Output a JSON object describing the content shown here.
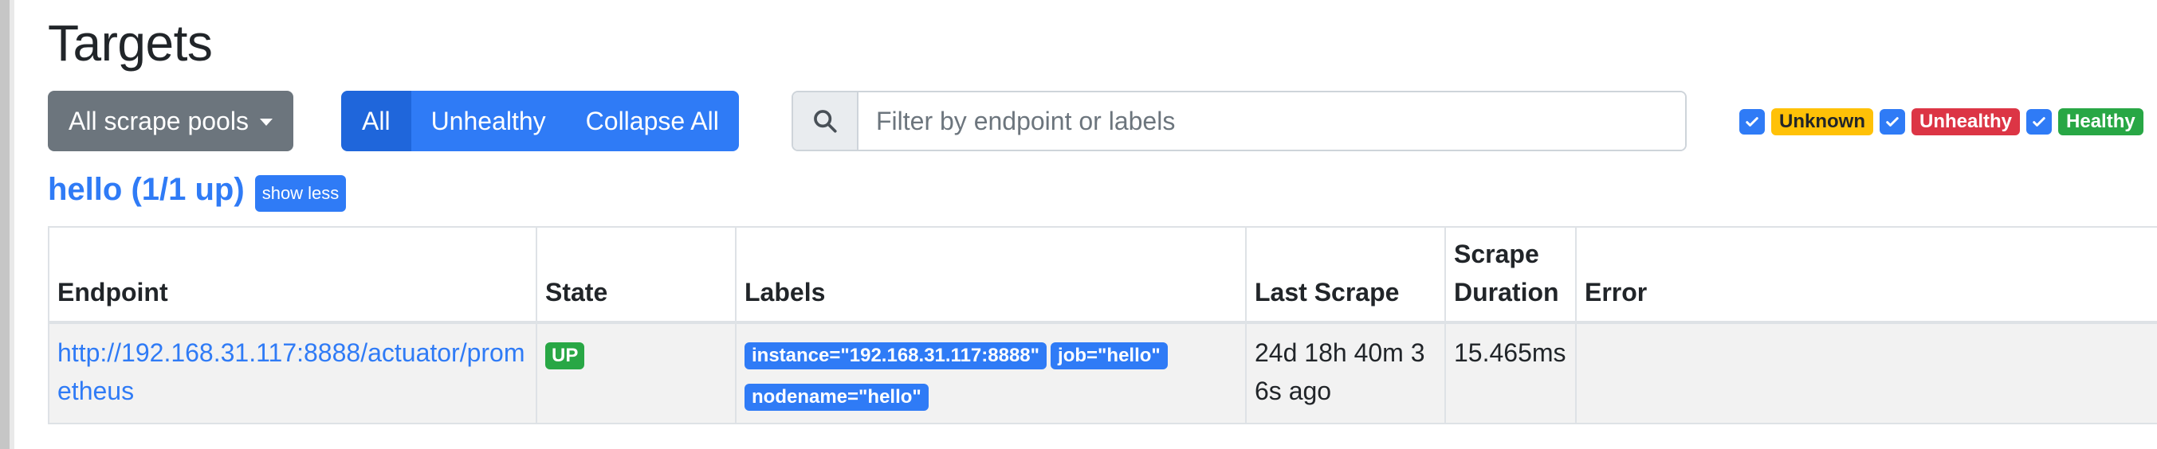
{
  "page": {
    "title": "Targets"
  },
  "toolbar": {
    "scrape_pools_label": "All scrape pools",
    "filter_buttons": [
      "All",
      "Unhealthy",
      "Collapse All"
    ],
    "search_placeholder": "Filter by endpoint or labels",
    "search_value": ""
  },
  "health_filters": [
    {
      "label": "Unknown",
      "checked": true,
      "color": "#ffc107"
    },
    {
      "label": "Unhealthy",
      "checked": true,
      "color": "#dc3545"
    },
    {
      "label": "Healthy",
      "checked": true,
      "color": "#28a745"
    }
  ],
  "pool": {
    "title": "hello (1/1 up)",
    "toggle_label": "show less"
  },
  "table": {
    "headers": {
      "endpoint": "Endpoint",
      "state": "State",
      "labels": "Labels",
      "last_scrape": "Last Scrape",
      "scrape_duration": "Scrape Duration",
      "error": "Error"
    },
    "rows": [
      {
        "endpoint": "http://192.168.31.117:8888/actuator/prometheus",
        "state": "UP",
        "labels": [
          "instance=\"192.168.31.117:8888\"",
          "job=\"hello\"",
          "nodename=\"hello\""
        ],
        "last_scrape": "24d 18h 40m 36s ago",
        "scrape_duration": "15.465ms",
        "error": ""
      }
    ]
  },
  "colors": {
    "primary": "#2f7bf6",
    "primary_active": "#1f66db",
    "secondary": "#6c757d",
    "success": "#28a745",
    "warning": "#ffc107",
    "danger": "#dc3545"
  }
}
